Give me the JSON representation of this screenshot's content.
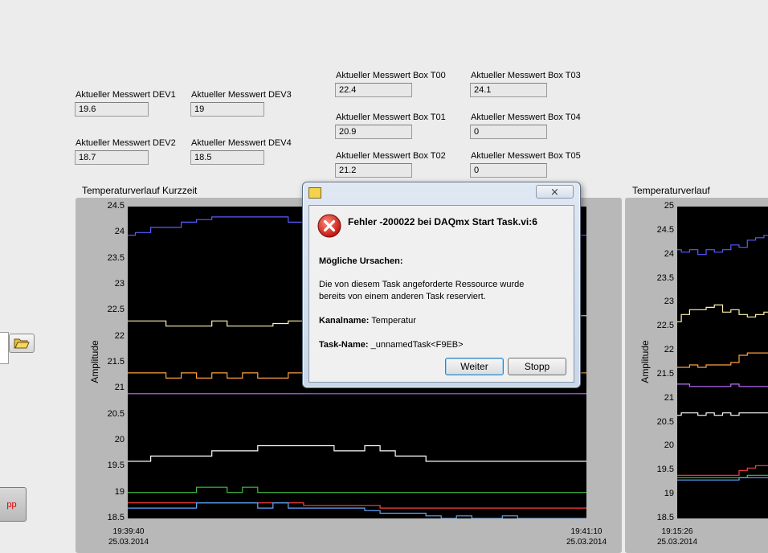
{
  "indicators": [
    {
      "label": "Aktueller Messwert DEV1",
      "value": "19.6"
    },
    {
      "label": "Aktueller Messwert DEV3",
      "value": "19"
    },
    {
      "label": "Aktueller Messwert DEV2",
      "value": "18.7"
    },
    {
      "label": "Aktueller Messwert DEV4",
      "value": "18.5"
    },
    {
      "label": "Aktueller Messwert Box T00",
      "value": "22.4"
    },
    {
      "label": "Aktueller Messwert Box T03",
      "value": "24.1"
    },
    {
      "label": "Aktueller Messwert Box T01",
      "value": "20.9"
    },
    {
      "label": "Aktueller Messwert Box T04",
      "value": "0"
    },
    {
      "label": "Aktueller Messwert Box T02",
      "value": "21.2"
    },
    {
      "label": "Aktueller Messwert Box T05",
      "value": "0"
    }
  ],
  "stop_button": {
    "label": "pp"
  },
  "folder_icon": "folder-open-icon",
  "colors": {
    "blue": "#5b5bff",
    "cream": "#fff5b0",
    "orange": "#ffa040",
    "purple": "#c070ff",
    "white": "#ffffff",
    "green": "#40c040",
    "red": "#ff4040",
    "lightblue": "#60a8ff"
  },
  "dialog": {
    "title": "Fehler -200022 bei DAQmx Start Task.vi:6",
    "causes_heading": "Mögliche Ursachen:",
    "message_line1": "Die von diesem Task angeforderte Ressource wurde",
    "message_line2": "bereits von einem anderen Task reserviert.",
    "channel_label": "Kanalname:",
    "channel_value": "Temperatur",
    "task_label": "Task-Name:",
    "task_value": "_unnamedTask<F9EB>",
    "continue_button": "Weiter",
    "stop_button": "Stopp",
    "close_symbol": "⨯"
  },
  "chart_data": [
    {
      "type": "line",
      "title": "Temperaturverlauf Kurzzeit",
      "ylabel": "Amplitude",
      "ylim": [
        18.5,
        24.5
      ],
      "yticks": [
        "24.5",
        "24",
        "23.5",
        "23",
        "22.5",
        "22",
        "21.5",
        "21",
        "20.5",
        "20",
        "19.5",
        "19",
        "18.5"
      ],
      "xticks": [
        {
          "time": "19:39:40",
          "date": "25.03.2014"
        },
        {
          "time": "19:41:10",
          "date": "25.03.2014"
        }
      ],
      "series": [
        {
          "color": "#5b5bff",
          "values": [
            23.95,
            24.0,
            24.1,
            24.1,
            24.2,
            24.25,
            24.3,
            24.3,
            24.3,
            24.3,
            24.3,
            24.2,
            24.2,
            24.2,
            24.2,
            24.2,
            24.2,
            24.2,
            24.2,
            24.2,
            24.1,
            24.1,
            24.1,
            24.1,
            24.1,
            24.1,
            24.0,
            24.0,
            24.0,
            24.0,
            23.95
          ]
        },
        {
          "color": "#fff5b0",
          "values": [
            22.3,
            22.3,
            22.3,
            22.2,
            22.2,
            22.2,
            22.3,
            22.2,
            22.2,
            22.2,
            22.25,
            22.3,
            22.35,
            22.4,
            22.4,
            22.4,
            22.4,
            22.4,
            22.4,
            22.4,
            22.4,
            22.4,
            22.4,
            22.4,
            22.4,
            22.4,
            22.4,
            22.4,
            22.4,
            22.4,
            22.4
          ]
        },
        {
          "color": "#ffa040",
          "values": [
            21.3,
            21.3,
            21.3,
            21.2,
            21.3,
            21.2,
            21.3,
            21.2,
            21.3,
            21.2,
            21.2,
            21.3,
            21.3,
            21.3,
            21.3,
            21.3,
            21.3,
            21.3,
            21.3,
            21.3,
            21.3,
            21.3,
            21.3,
            21.3,
            21.3,
            21.3,
            21.3,
            21.3,
            21.3,
            21.3,
            21.3
          ]
        },
        {
          "color": "#c070ff",
          "values": [
            20.9,
            20.9,
            20.9,
            20.9,
            20.9,
            20.9,
            20.9,
            20.9,
            20.9,
            20.9,
            20.9,
            20.9,
            20.9,
            20.9,
            20.9,
            20.9,
            20.9,
            20.9,
            20.9,
            20.9,
            20.9,
            20.9,
            20.9,
            20.9,
            20.9,
            20.9,
            20.9,
            20.9,
            20.9,
            20.9,
            20.9
          ]
        },
        {
          "color": "#ffffff",
          "values": [
            19.6,
            19.6,
            19.7,
            19.7,
            19.7,
            19.7,
            19.8,
            19.8,
            19.8,
            19.9,
            19.9,
            19.9,
            19.9,
            19.9,
            19.8,
            19.8,
            19.9,
            19.8,
            19.7,
            19.7,
            19.6,
            19.6,
            19.6,
            19.6,
            19.6,
            19.6,
            19.6,
            19.6,
            19.6,
            19.6,
            19.6
          ]
        },
        {
          "color": "#40c040",
          "values": [
            19.0,
            19.0,
            19.0,
            19.0,
            19.0,
            19.1,
            19.1,
            19.0,
            19.1,
            19.0,
            19.0,
            19.0,
            19.0,
            19.0,
            19.0,
            19.0,
            19.0,
            19.0,
            19.0,
            19.0,
            19.0,
            19.0,
            19.0,
            19.0,
            19.0,
            19.0,
            19.0,
            19.0,
            19.0,
            19.0,
            19.0
          ]
        },
        {
          "color": "#ff4040",
          "values": [
            18.8,
            18.8,
            18.8,
            18.8,
            18.8,
            18.8,
            18.8,
            18.8,
            18.8,
            18.8,
            18.8,
            18.8,
            18.75,
            18.75,
            18.75,
            18.75,
            18.75,
            18.7,
            18.7,
            18.7,
            18.7,
            18.7,
            18.7,
            18.7,
            18.7,
            18.7,
            18.7,
            18.7,
            18.7,
            18.7,
            18.7
          ]
        },
        {
          "color": "#60a8ff",
          "values": [
            18.7,
            18.7,
            18.7,
            18.7,
            18.7,
            18.8,
            18.8,
            18.8,
            18.8,
            18.7,
            18.8,
            18.7,
            18.7,
            18.7,
            18.7,
            18.7,
            18.65,
            18.6,
            18.6,
            18.6,
            18.55,
            18.5,
            18.55,
            18.5,
            18.5,
            18.55,
            18.5,
            18.5,
            18.5,
            18.5,
            18.5
          ]
        }
      ]
    },
    {
      "type": "line",
      "title": "Temperaturverlauf",
      "ylabel": "Amplitude",
      "ylim": [
        18.5,
        25
      ],
      "yticks": [
        "25",
        "24.5",
        "24",
        "23.5",
        "23",
        "22.5",
        "22",
        "21.5",
        "21",
        "20.5",
        "20",
        "19.5",
        "19",
        "18.5"
      ],
      "xticks": [
        {
          "time": "19:15:26",
          "date": "25.03.2014"
        }
      ],
      "series": [
        {
          "color": "#5b5bff",
          "values": [
            24.1,
            24.05,
            24.1,
            24.0,
            24.1,
            24.05,
            24.1,
            24.2,
            24.15,
            24.3,
            24.35,
            24.4
          ]
        },
        {
          "color": "#fff5b0",
          "values": [
            22.6,
            22.75,
            22.85,
            22.85,
            22.9,
            22.95,
            22.8,
            22.85,
            22.75,
            22.7,
            22.75,
            22.8
          ]
        },
        {
          "color": "#ffa040",
          "values": [
            21.65,
            21.65,
            21.7,
            21.65,
            21.7,
            21.7,
            21.7,
            21.75,
            21.9,
            21.95,
            21.95,
            21.95
          ]
        },
        {
          "color": "#c070ff",
          "values": [
            21.3,
            21.3,
            21.25,
            21.25,
            21.25,
            21.25,
            21.25,
            21.3,
            21.25,
            21.25,
            21.25,
            21.25
          ]
        },
        {
          "color": "#ffffff",
          "values": [
            20.65,
            20.7,
            20.7,
            20.65,
            20.7,
            20.65,
            20.7,
            20.65,
            20.7,
            20.7,
            20.7,
            20.7
          ]
        },
        {
          "color": "#ff4040",
          "values": [
            19.4,
            19.4,
            19.4,
            19.4,
            19.4,
            19.4,
            19.4,
            19.4,
            19.5,
            19.55,
            19.6,
            19.6
          ]
        },
        {
          "color": "#40c040",
          "values": [
            19.35,
            19.35,
            19.35,
            19.35,
            19.35,
            19.35,
            19.35,
            19.35,
            19.35,
            19.4,
            19.4,
            19.4
          ]
        },
        {
          "color": "#60a8ff",
          "values": [
            19.3,
            19.3,
            19.3,
            19.3,
            19.3,
            19.3,
            19.3,
            19.3,
            19.35,
            19.35,
            19.35,
            19.35
          ]
        }
      ]
    }
  ]
}
